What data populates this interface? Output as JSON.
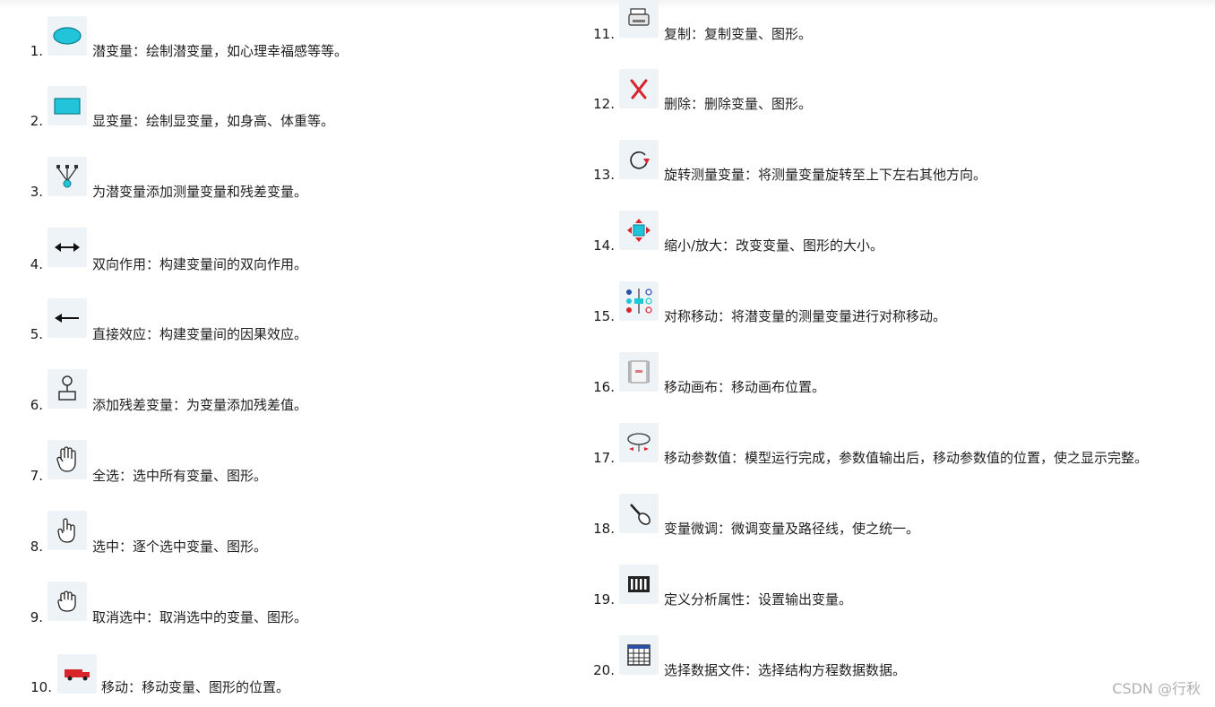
{
  "left_items": [
    {
      "num": "1.",
      "icon": "ellipse-icon",
      "text": "潜变量：绘制潜变量，如心理幸福感等等。"
    },
    {
      "num": "2.",
      "icon": "rectangle-icon",
      "text": "显变量：绘制显变量，如身高、体重等。"
    },
    {
      "num": "3.",
      "icon": "indicator-tree-icon",
      "text": "为潜变量添加测量变量和残差变量。"
    },
    {
      "num": "4.",
      "icon": "double-arrow-icon",
      "text": "双向作用：构建变量间的双向作用。"
    },
    {
      "num": "5.",
      "icon": "left-arrow-icon",
      "text": "直接效应：构建变量间的因果效应。"
    },
    {
      "num": "6.",
      "icon": "residual-icon",
      "text": "添加残差变量：为变量添加残差值。"
    },
    {
      "num": "7.",
      "icon": "hand-all-icon",
      "text": "全选：选中所有变量、图形。"
    },
    {
      "num": "8.",
      "icon": "hand-pointer-icon",
      "text": "选中：逐个选中变量、图形。"
    },
    {
      "num": "9.",
      "icon": "hand-cancel-icon",
      "text": "取消选中：取消选中的变量、图形。"
    },
    {
      "num": "10.",
      "icon": "truck-icon",
      "text": "移动：移动变量、图形的位置。"
    }
  ],
  "right_items": [
    {
      "num": "11.",
      "icon": "copy-machine-icon",
      "text": "复制：复制变量、图形。"
    },
    {
      "num": "12.",
      "icon": "delete-x-icon",
      "text": "删除：删除变量、图形。"
    },
    {
      "num": "13.",
      "icon": "rotate-icon",
      "text": "旋转测量变量：将测量变量旋转至上下左右其他方向。"
    },
    {
      "num": "14.",
      "icon": "resize-icon",
      "text": "缩小/放大：改变变量、图形的大小。"
    },
    {
      "num": "15.",
      "icon": "reflect-icon",
      "text": "对称移动：将潜变量的测量变量进行对称移动。"
    },
    {
      "num": "16.",
      "icon": "canvas-scroll-icon",
      "text": "移动画布：移动画布位置。"
    },
    {
      "num": "17.",
      "icon": "move-parameter-icon",
      "text": "移动参数值：模型运行完成，参数值输出后，移动参数值的位置，使之显示完整。"
    },
    {
      "num": "18.",
      "icon": "touch-up-icon",
      "text": "变量微调：微调变量及路径线，使之统一。"
    },
    {
      "num": "19.",
      "icon": "analysis-properties-icon",
      "text": "定义分析属性：设置输出变量。"
    },
    {
      "num": "20.",
      "icon": "data-file-icon",
      "text": "选择数据文件：选择结构方程数据数据。"
    }
  ],
  "watermark": "CSDN @行秋",
  "colors": {
    "icon_bg": "#eef3f8",
    "accent_cyan": "#21c4d8",
    "accent_red": "#d9242b"
  }
}
